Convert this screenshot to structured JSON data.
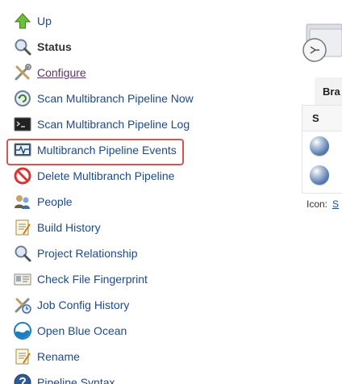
{
  "sidepanel": {
    "items": [
      {
        "label": "Up",
        "icon": "up-arrow-icon"
      },
      {
        "label": "Status",
        "icon": "search-icon"
      },
      {
        "label": "Configure",
        "icon": "configure-tools-icon"
      },
      {
        "label": "Scan Multibranch Pipeline Now",
        "icon": "scan-refresh-icon"
      },
      {
        "label": "Scan Multibranch Pipeline Log",
        "icon": "terminal-icon"
      },
      {
        "label": "Multibranch Pipeline Events",
        "icon": "monitor-pulse-icon"
      },
      {
        "label": "Delete Multibranch Pipeline",
        "icon": "no-entry-icon"
      },
      {
        "label": "People",
        "icon": "people-icon"
      },
      {
        "label": "Build History",
        "icon": "notepad-icon"
      },
      {
        "label": "Project Relationship",
        "icon": "search-icon"
      },
      {
        "label": "Check File Fingerprint",
        "icon": "fingerprint-card-icon"
      },
      {
        "label": "Job Config History",
        "icon": "config-history-icon"
      },
      {
        "label": "Open Blue Ocean",
        "icon": "blue-ocean-icon"
      },
      {
        "label": "Rename",
        "icon": "notepad-icon"
      },
      {
        "label": "Pipeline Syntax",
        "icon": "help-icon"
      }
    ],
    "highlighted_item": "Multibranch Pipeline Events"
  },
  "main": {
    "tab_label": "Bra",
    "table_header": "S",
    "legend_label": "Icon:",
    "legend_link": "S"
  },
  "colors": {
    "link": "#204a87",
    "highlight_border": "#d9534f",
    "visited_link": "#5c3566"
  }
}
